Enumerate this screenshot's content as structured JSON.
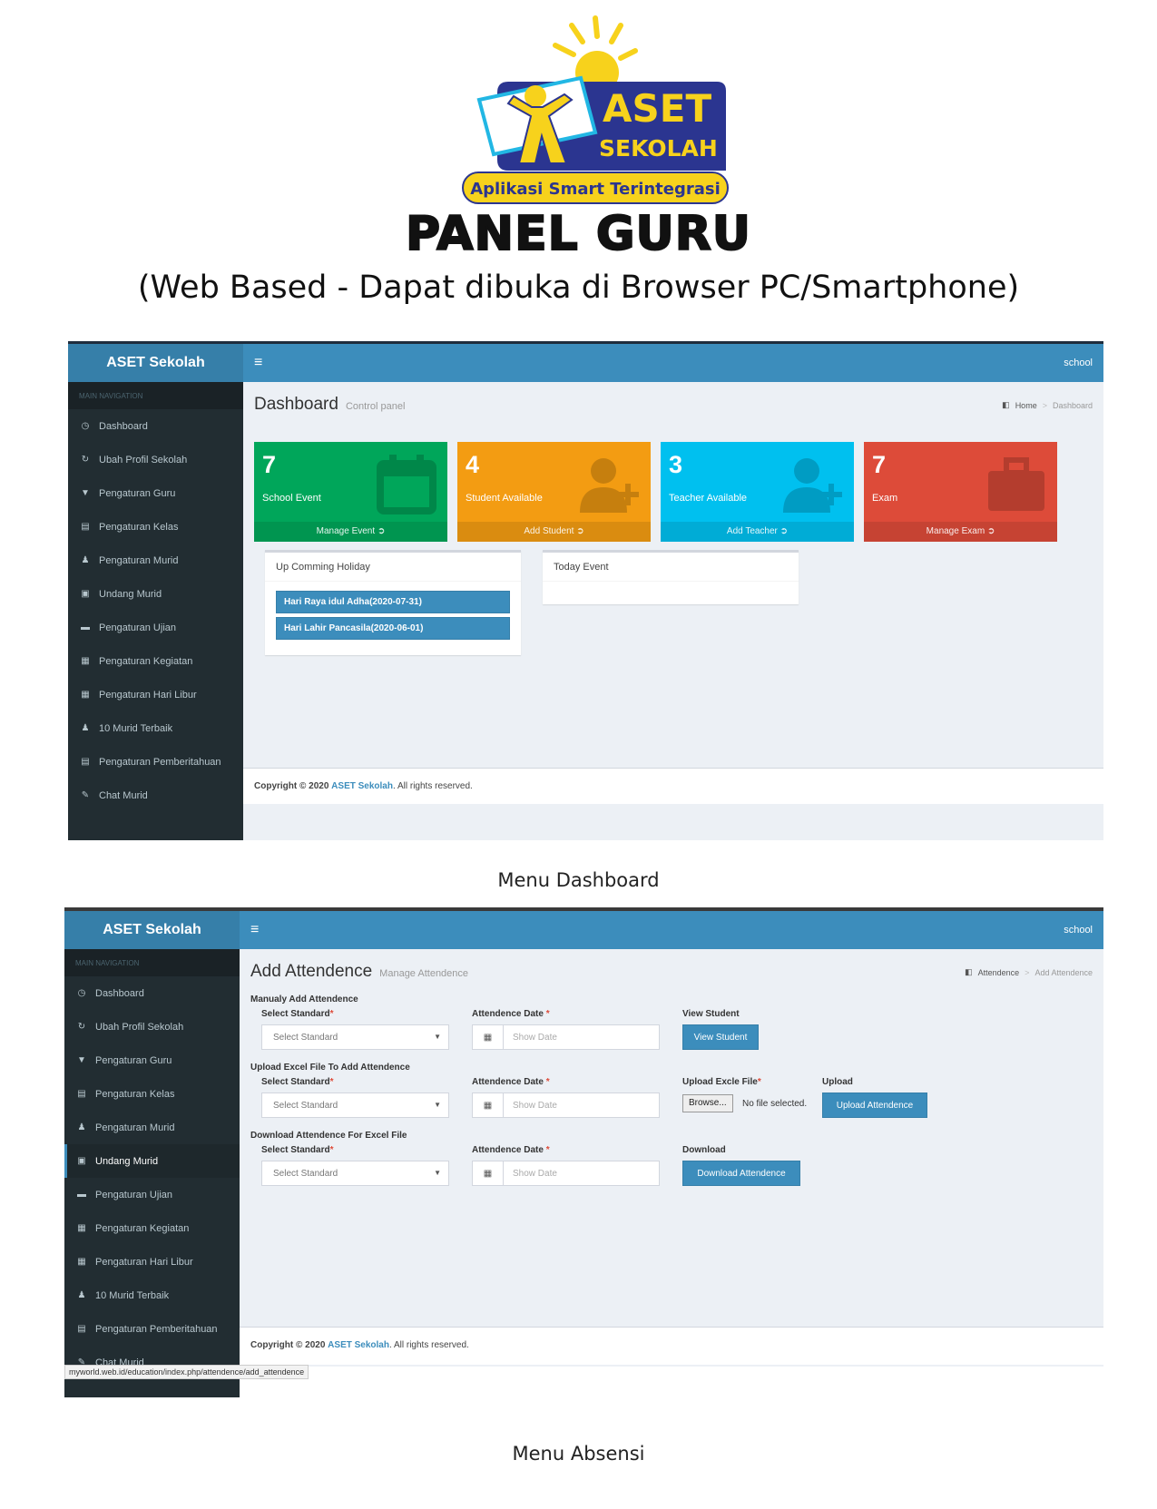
{
  "logo": {
    "brand_line1": "ASET",
    "brand_line2": "SEKOLAH",
    "tagline": "Aplikasi Smart Terintegrasi",
    "colors": {
      "navy": "#2b3590",
      "yellow": "#f7d21c",
      "cyan": "#22b7e4"
    }
  },
  "heading": {
    "title": "PANEL GURU",
    "subtitle": "(Web Based - Dapat dibuka di Browser PC/Smartphone)"
  },
  "dashboard": {
    "brand": "ASET Sekolah",
    "user": "school",
    "nav_header": "MAIN NAVIGATION",
    "nav": [
      {
        "label": "Dashboard",
        "icon": "dashboard-icon",
        "glyph": "◷"
      },
      {
        "label": "Ubah Profil Sekolah",
        "icon": "refresh-icon",
        "glyph": "↻"
      },
      {
        "label": "Pengaturan Guru",
        "icon": "graduation-cap-icon",
        "glyph": "▼"
      },
      {
        "label": "Pengaturan Kelas",
        "icon": "list-icon",
        "glyph": "▤"
      },
      {
        "label": "Pengaturan Murid",
        "icon": "user-icon",
        "glyph": "♟"
      },
      {
        "label": "Undang Murid",
        "icon": "calendar-check-icon",
        "glyph": "▣"
      },
      {
        "label": "Pengaturan Ujian",
        "icon": "briefcase-icon",
        "glyph": "▬"
      },
      {
        "label": "Pengaturan Kegiatan",
        "icon": "calendar-icon",
        "glyph": "▦"
      },
      {
        "label": "Pengaturan Hari Libur",
        "icon": "calendar-icon",
        "glyph": "▦"
      },
      {
        "label": "10 Murid Terbaik",
        "icon": "user-icon",
        "glyph": "♟"
      },
      {
        "label": "Pengaturan Pemberitahuan",
        "icon": "list-icon",
        "glyph": "▤"
      },
      {
        "label": "Chat Murid",
        "icon": "edit-icon",
        "glyph": "✎"
      }
    ],
    "page_title": "Dashboard",
    "page_subtitle": "Control panel",
    "breadcrumb": {
      "home": "Home",
      "current": "Dashboard"
    },
    "boxes": [
      {
        "number": "7",
        "label": "School Event",
        "footer": "Manage Event",
        "color": "#00a65a",
        "icon": "calendar-icon"
      },
      {
        "number": "4",
        "label": "Student Available",
        "footer": "Add Student",
        "color": "#f39c12",
        "icon": "user-plus-icon"
      },
      {
        "number": "3",
        "label": "Teacher Available",
        "footer": "Add Teacher",
        "color": "#00c0ef",
        "icon": "user-plus-icon"
      },
      {
        "number": "7",
        "label": "Exam",
        "footer": "Manage Exam",
        "color": "#dd4b39",
        "icon": "briefcase-icon"
      }
    ],
    "holiday_card": {
      "title": "Up Comming Holiday",
      "items": [
        "Hari Raya idul Adha(2020-07-31)",
        "Hari Lahir Pancasila(2020-06-01)"
      ]
    },
    "event_card": {
      "title": "Today Event"
    },
    "footer": {
      "prefix": "Copyright © 2020",
      "link": "ASET Sekolah",
      "suffix": ". All rights reserved."
    },
    "caption": "Menu Dashboard"
  },
  "attendance": {
    "brand": "ASET Sekolah",
    "user": "school",
    "nav_header": "MAIN NAVIGATION",
    "active_index": 5,
    "page_title": "Add Attendence",
    "page_subtitle": "Manage Attendence",
    "breadcrumb": {
      "home": "Attendence",
      "current": "Add Attendence"
    },
    "sections": [
      {
        "title": "Manualy Add Attendence",
        "standard_label": "Select Standard",
        "standard_placeholder": "Select Standard",
        "date_label": "Attendence Date",
        "date_placeholder": "Show Date",
        "action_label": "View Student",
        "action_button": "View Student"
      },
      {
        "title": "Upload Excel File To Add Attendence",
        "standard_label": "Select Standard",
        "standard_placeholder": "Select Standard",
        "date_label": "Attendence Date",
        "date_placeholder": "Show Date",
        "file_label": "Upload Excle File",
        "browse": "Browse...",
        "no_file": "No file selected.",
        "action_label": "Upload",
        "action_button": "Upload Attendence"
      },
      {
        "title": "Download Attendence For Excel File",
        "standard_label": "Select Standard",
        "standard_placeholder": "Select Standard",
        "date_label": "Attendence Date",
        "date_placeholder": "Show Date",
        "action_label": "Download",
        "action_button": "Download Attendence"
      }
    ],
    "footer": {
      "prefix": "Copyright © 2020",
      "link": "ASET Sekolah",
      "suffix": ". All rights reserved."
    },
    "status_url": "myworld.web.id/education/index.php/attendence/add_attendence",
    "caption": "Menu Absensi"
  }
}
